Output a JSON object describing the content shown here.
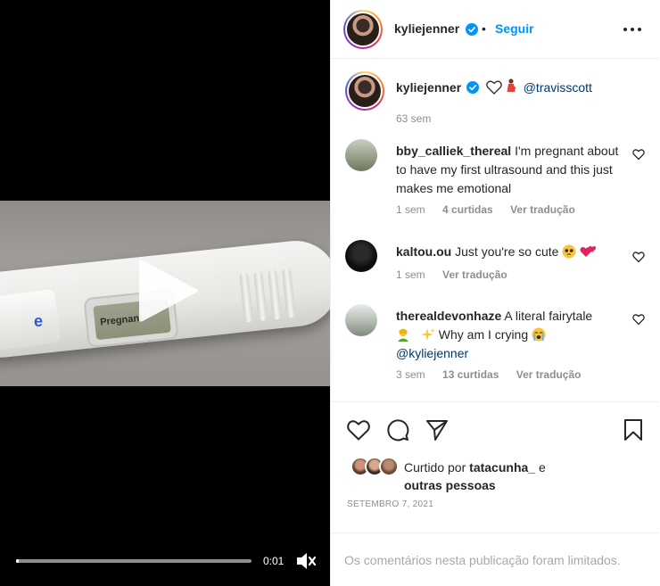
{
  "video": {
    "screen_text": "Pregnant",
    "brand_letter": "e",
    "time": "0:01",
    "progress": 0.01
  },
  "header": {
    "username": "kyliejenner",
    "separator": "•",
    "follow_label": "Seguir"
  },
  "caption": {
    "username": "kyliejenner",
    "mention": "@travisscott",
    "age": "63 sem"
  },
  "comments": [
    {
      "username": "bby_calliek_thereal",
      "text": "I'm pregnant about to have my first ultrasound and this just makes me emotional",
      "age": "1 sem",
      "likes": "4 curtidas",
      "translate": "Ver tradução"
    },
    {
      "username": "kaltou.ou",
      "text": "Just you're so cute",
      "age": "1 sem",
      "translate": "Ver tradução"
    },
    {
      "username": "therealdevonhaze",
      "text_a": "A literal fairytale",
      "text_b": "Why am I crying",
      "mention": "@kyliejenner",
      "age": "3 sem",
      "likes": "13 curtidas",
      "translate": "Ver tradução"
    }
  ],
  "likes": {
    "prefix": "Curtido por",
    "user": "tatacunha_",
    "conj": "e",
    "others": "outras pessoas"
  },
  "post_date": "SETEMBRO 7, 2021",
  "limited_notice": "Os comentários nesta publicação foram limitados.",
  "colors": {
    "accent": "#0095f6",
    "text": "#262626",
    "muted": "#8e8e8e",
    "border": "#efefef"
  },
  "icons": [
    "play-icon",
    "mute-icon",
    "verified-icon",
    "more-icon",
    "heart-icon",
    "comment-icon",
    "share-icon",
    "save-icon",
    "white-heart-emoji",
    "pregnant-emoji",
    "pleading-emoji",
    "two-hearts-emoji",
    "lady-emoji",
    "sparkles-emoji",
    "crying-emoji"
  ]
}
